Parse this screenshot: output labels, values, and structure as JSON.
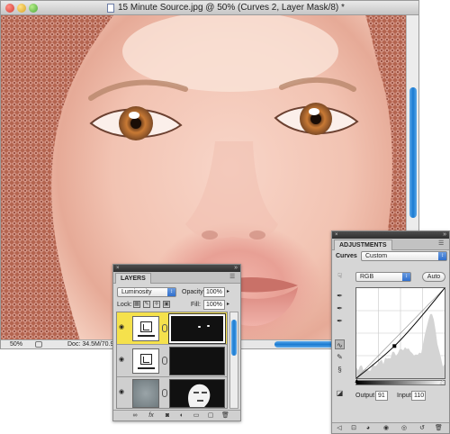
{
  "document": {
    "title": "15 Minute Source.jpg @ 50% (Curves 2, Layer Mask/8) *",
    "zoom": "50%",
    "doc_size": "Doc: 34.5M/70.9",
    "scroll_position_fraction": 0.22
  },
  "layers_panel": {
    "tab": "LAYERS",
    "blend_mode": "Luminosity",
    "opacity_label": "Opacity:",
    "opacity_value": "100%",
    "lock_label": "Lock:",
    "fill_label": "Fill:",
    "fill_value": "100%",
    "layers": [
      {
        "type": "curves-adjustment",
        "selected": true,
        "visible": true,
        "mask": "eye-highlights"
      },
      {
        "type": "curves-adjustment",
        "selected": false,
        "visible": true,
        "mask": "black"
      },
      {
        "type": "image",
        "selected": false,
        "visible": true,
        "mask": "face-silhouette"
      }
    ],
    "footer_icons": [
      "link-icon",
      "fx-icon",
      "mask-icon",
      "adjustment-icon",
      "folder-icon",
      "new-layer-icon",
      "trash-icon"
    ]
  },
  "adjustments_panel": {
    "tab": "ADJUSTMENTS",
    "curves_label": "Curves",
    "preset": "Custom",
    "channel": "RGB",
    "auto_label": "Auto",
    "output_label": "Output",
    "output_value": "91",
    "input_label": "Input",
    "input_value": "110",
    "curve_point": {
      "input": 110,
      "output": 91
    }
  },
  "colors": {
    "selection_yellow": "#f5e14c",
    "accent_blue": "#1a7ad1"
  }
}
